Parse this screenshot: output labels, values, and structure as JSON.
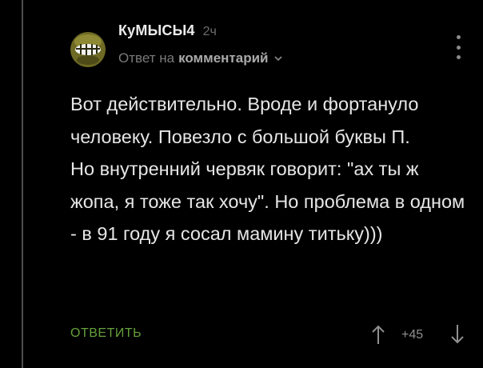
{
  "comment": {
    "author": "КуМЫСЫ4",
    "time": "2ч",
    "reply_prefix": "Ответ на",
    "reply_target": "комментарий",
    "body_lines": [
      "Вот действительно. Вроде и фортануло человеку. Повезло с большой буквы П.",
      "Но внутренний червяк говорит: \"ах ты ж жопа, я тоже так хочу\". Но проблема в одном - в 91 году я сосал мамину титьку)))"
    ],
    "reply_label": "ОТВЕТИТЬ",
    "rating": "+45"
  },
  "icons": {
    "avatar": "smiling-face-avatar",
    "reply_chevron": "chevron-down-icon",
    "menu": "kebab-menu-icon",
    "vote_up": "arrow-up-icon",
    "vote_down": "arrow-down-icon"
  },
  "colors": {
    "background": "#000000",
    "text": "#e6e6e6",
    "muted": "#7a7a7a",
    "accent_green": "#66a03a",
    "thread_line": "#4f4f4f"
  }
}
